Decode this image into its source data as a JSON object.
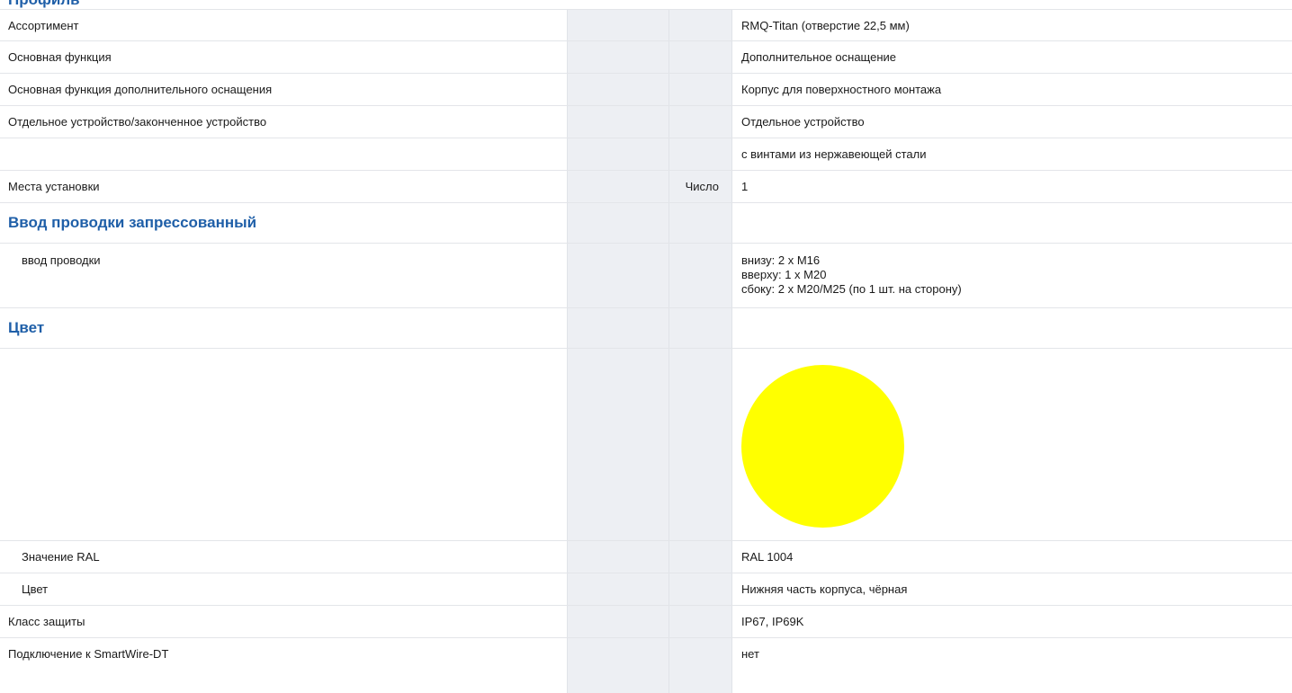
{
  "clipped_heading": "Профиль",
  "rows": [
    {
      "label": "Ассортимент",
      "unit": "",
      "value": "RMQ-Titan (отверстие 22,5 мм)"
    },
    {
      "label": "Основная функция",
      "unit": "",
      "value": "Дополнительное оснащение"
    },
    {
      "label": "Основная функция дополнительного оснащения",
      "unit": "",
      "value": "Корпус для поверхностного монтажа"
    },
    {
      "label": "Отдельное устройство/законченное устройство",
      "unit": "",
      "value": "Отдельное устройство"
    },
    {
      "label": "",
      "unit": "",
      "value": "с винтами из нержавеющей стали"
    },
    {
      "label": "Места установки",
      "unit": "Число",
      "value": "1"
    }
  ],
  "section_wiring": {
    "title": "Ввод проводки запрессованный",
    "label": "ввод проводки",
    "lines": [
      "внизу: 2 x M16",
      "вверху: 1 x M20",
      "сбоку: 2 x M20/M25 (по 1 шт. на сторону)"
    ]
  },
  "section_color": {
    "title": "Цвет",
    "swatch_color": "#ffff00",
    "ral_label": "Значение RAL",
    "ral_value": "RAL 1004",
    "color_label": "Цвет",
    "color_value": "Нижняя часть корпуса, чёрная"
  },
  "rows_tail": [
    {
      "label": "Класс защиты",
      "unit": "",
      "value": "IP67, IP69K"
    },
    {
      "label": "Подключение к SmartWire-DT",
      "unit": "",
      "value": "нет"
    }
  ],
  "colors": {
    "heading": "#1f5fa8",
    "shade": "#edeff3",
    "divider": "#e3e5e9"
  }
}
